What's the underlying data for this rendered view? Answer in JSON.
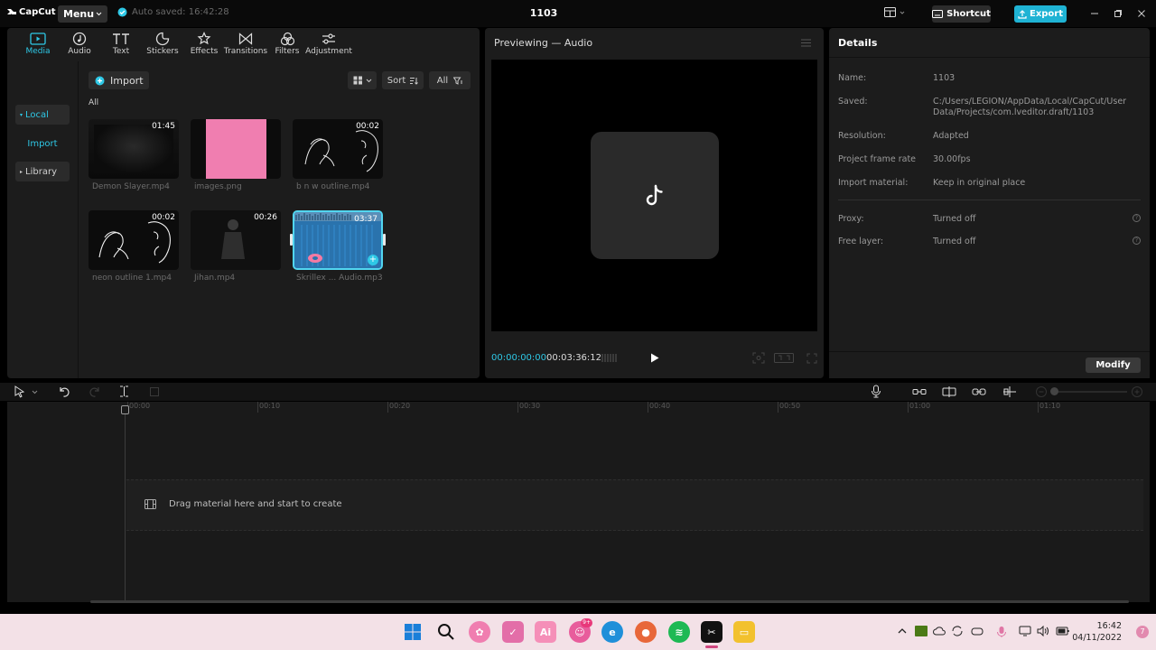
{
  "titlebar": {
    "app_name": "CapCut",
    "menu_label": "Menu",
    "autosave": "Auto saved: 16:42:28",
    "project_title": "1103",
    "shortcut_label": "Shortcut",
    "export_label": "Export"
  },
  "media": {
    "tabs": [
      {
        "label": "Media",
        "icon": "media-icon"
      },
      {
        "label": "Audio",
        "icon": "audio-icon"
      },
      {
        "label": "Text",
        "icon": "text-icon"
      },
      {
        "label": "Stickers",
        "icon": "stickers-icon"
      },
      {
        "label": "Effects",
        "icon": "effects-icon"
      },
      {
        "label": "Transitions",
        "icon": "transitions-icon"
      },
      {
        "label": "Filters",
        "icon": "filters-icon"
      },
      {
        "label": "Adjustment",
        "icon": "adjustment-icon"
      }
    ],
    "side": {
      "local": "Local",
      "import": "Import",
      "library": "Library"
    },
    "import_label": "Import",
    "sort_label": "Sort",
    "filter_label": "All",
    "all_label": "All",
    "items": [
      {
        "name": "Demon Slayer.mp4",
        "duration": "01:45"
      },
      {
        "name": "images.png",
        "duration": ""
      },
      {
        "name": "b n w outline.mp4",
        "duration": "00:02"
      },
      {
        "name": "neon outline 1.mp4",
        "duration": "00:02"
      },
      {
        "name": "Jihan.mp4",
        "duration": "00:26"
      },
      {
        "name": "Skrillex ... Audio.mp3",
        "duration": "03:37"
      }
    ]
  },
  "preview": {
    "title": "Previewing — Audio",
    "current_time": "00:00:00:00",
    "total_time": "00:03:36:12"
  },
  "details": {
    "title": "Details",
    "rows": [
      {
        "label": "Name:",
        "value": "1103"
      },
      {
        "label": "Saved:",
        "value": "C:/Users/LEGION/AppData/Local/CapCut/User Data/Projects/com.lveditor.draft/1103"
      },
      {
        "label": "Resolution:",
        "value": "Adapted"
      },
      {
        "label": "Project frame rate",
        "value": "30.00fps"
      },
      {
        "label": "Import material:",
        "value": "Keep in original place"
      },
      {
        "label": "Proxy:",
        "value": "Turned off"
      },
      {
        "label": "Free layer:",
        "value": "Turned off"
      }
    ],
    "modify_label": "Modify"
  },
  "timeline": {
    "ticks": [
      "00:00",
      "00:10",
      "00:20",
      "00:30",
      "00:40",
      "00:50",
      "01:00",
      "01:10"
    ],
    "drag_hint": "Drag material here and start to create"
  },
  "taskbar": {
    "time": "16:42",
    "date": "04/11/2022",
    "badge": "9+"
  },
  "colors": {
    "accent": "#2ec8e6",
    "export": "#1fb3d4",
    "panel": "#1c1c1c",
    "taskbar": "#f3e1e7"
  }
}
